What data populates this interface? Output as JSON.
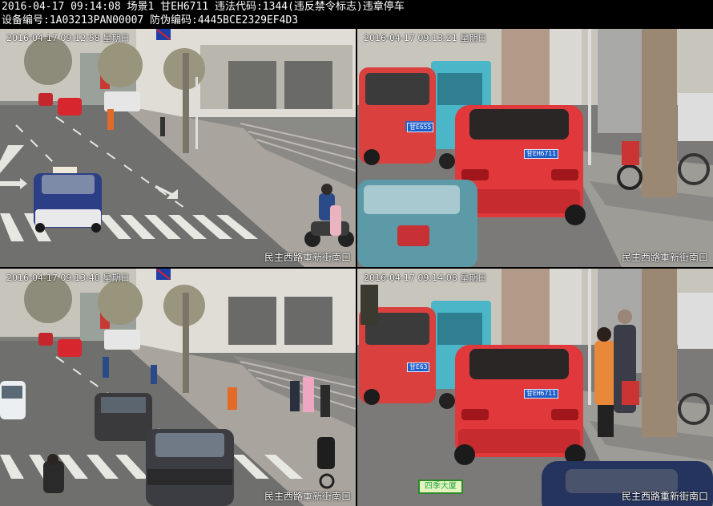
{
  "header": {
    "line1": "2016-04-17 09:14:08 场景1 甘EH6711 违法代码:1344(违反禁令标志)违章停车",
    "line2": "设备编号:1A03213PAN00007 防伪编码:4445BCE2329EF4D3"
  },
  "panels": [
    {
      "timestamp": "2016-04-17 09:12:58 星期日",
      "location": "民主西路重新街南口"
    },
    {
      "timestamp": "2016-04-17 09:13:21 星期日",
      "location": "民主西路重新街南口"
    },
    {
      "timestamp": "2016-04-17 09:13:40 星期日",
      "location": "民主西路重新街南口"
    },
    {
      "timestamp": "2016-04-17 09:14:08 星期日",
      "location": "民主西路重新街南口"
    }
  ],
  "plates": {
    "violator": "甘EH6711",
    "neighbor": "甘E655",
    "neighbor2": "甘E63"
  },
  "signs": {
    "building_sign": "四季大厦"
  }
}
